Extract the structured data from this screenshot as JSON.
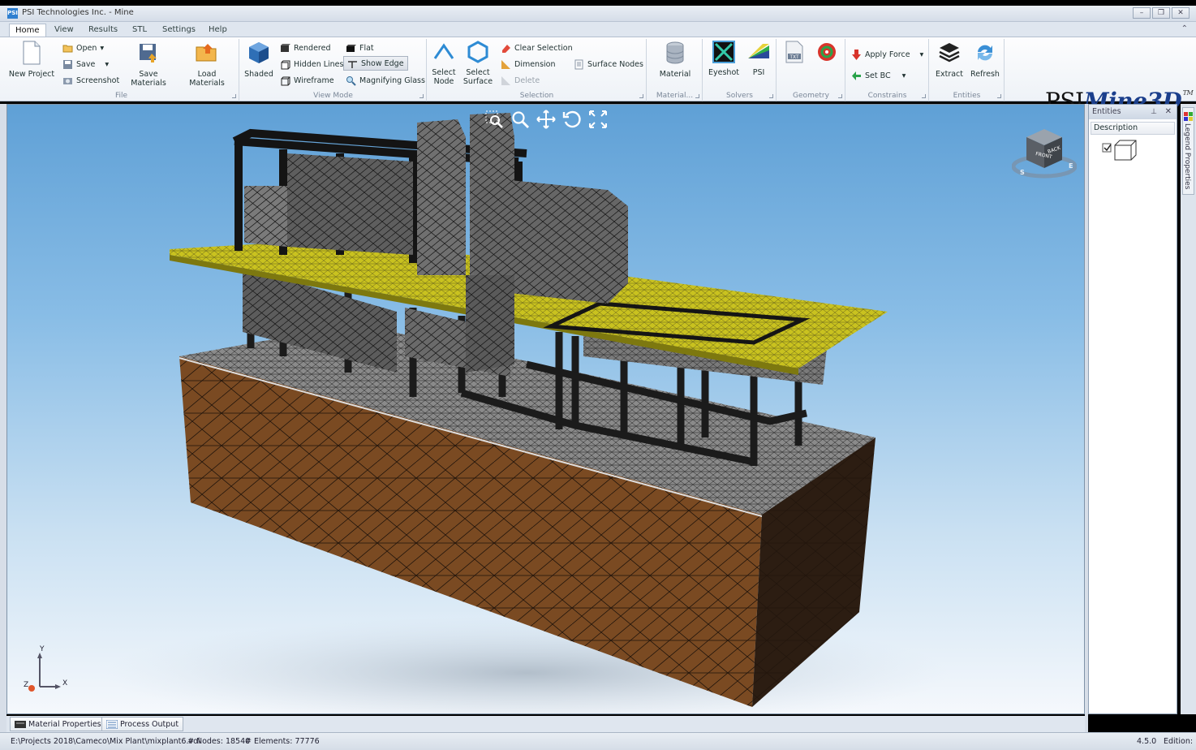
{
  "window": {
    "title": "PSI Technologies Inc. - Mine",
    "icon_text": "PSI",
    "minimize": "–",
    "restore": "❐",
    "close": "✕"
  },
  "tabs": [
    "Home",
    "View",
    "Results",
    "STL",
    "Settings",
    "Help"
  ],
  "ribbon": {
    "file": {
      "caption": "File",
      "new_project": "New Project",
      "open": "Open",
      "save": "Save",
      "screenshot": "Screenshot",
      "save_materials": "Save Materials",
      "load_materials": "Load Materials"
    },
    "view_mode": {
      "caption": "View Mode",
      "shaded": "Shaded",
      "rendered": "Rendered",
      "hidden_lines": "Hidden Lines",
      "wireframe": "Wireframe",
      "flat": "Flat",
      "show_edge": "Show Edge",
      "magnifying_glass": "Magnifying Glass"
    },
    "selection": {
      "caption": "Selection",
      "select_node_1": "Select",
      "select_node_2": "Node",
      "select_surface_1": "Select",
      "select_surface_2": "Surface",
      "clear_selection": "Clear Selection",
      "dimension": "Dimension",
      "delete": "Delete",
      "surface_nodes": "Surface Nodes"
    },
    "material": {
      "caption": "Material...",
      "material": "Material"
    },
    "solvers": {
      "caption": "Solvers",
      "eyeshot": "Eyeshot",
      "psi": "PSI"
    },
    "geometry": {
      "caption": "Geometry",
      "txt": "TXT"
    },
    "constrains": {
      "caption": "Constrains",
      "apply_force": "Apply Force",
      "set_bc": "Set BC"
    },
    "entities": {
      "caption": "Entities",
      "extract": "Extract",
      "refresh": "Refresh"
    }
  },
  "brand": {
    "psi": "PSI",
    "mine3d": "Mine3D",
    "tm": "TM"
  },
  "navcube": {
    "front": "FRONT",
    "back": "BACK",
    "s": "S",
    "e": "E"
  },
  "axis": {
    "y": "Y",
    "x": "X",
    "z": "Z"
  },
  "entities_panel": {
    "title": "Entities",
    "pin": "ᵖ",
    "close": "✕",
    "column": "Description",
    "items": [
      {
        "checked": true
      }
    ]
  },
  "legend_tab": "Legend Properties",
  "bottom_tabs": [
    "Material Properties",
    "Process Output"
  ],
  "status": {
    "path": "E:\\Projects 2018\\Cameco\\Mix Plant\\mixplant6.vol",
    "nodes": "# Nodes: 18540",
    "elements": "# Elements: 77776",
    "version": "4.5.0",
    "edition": "Edition:"
  },
  "colors": {
    "ground": "#7a4a22",
    "deck": "#c9c21f",
    "steel": "#2a2a2a",
    "mesh_gray": "#6a6a6a",
    "sky_top": "#5fa0d6"
  }
}
